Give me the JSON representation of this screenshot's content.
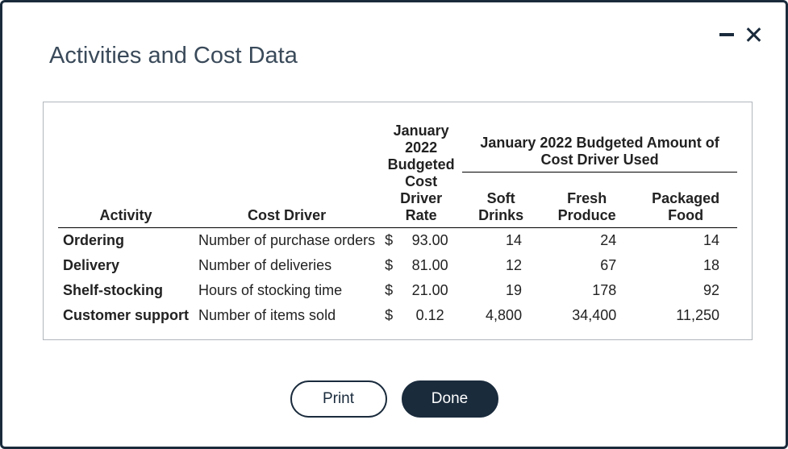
{
  "title": "Activities and Cost Data",
  "headers": {
    "activity": "Activity",
    "cost_driver": "Cost Driver",
    "rate": "January 2022 Budgeted Cost Driver Rate",
    "group": "January 2022 Budgeted Amount of Cost Driver Used",
    "soft_drinks": "Soft Drinks",
    "fresh_produce": "Fresh Produce",
    "packaged_food": "Packaged Food"
  },
  "rows": [
    {
      "activity": "Ordering",
      "driver": "Number of purchase orders",
      "currency": "$",
      "rate": "93.00",
      "soft": "14",
      "fresh": "24",
      "packaged": "14"
    },
    {
      "activity": "Delivery",
      "driver": "Number of deliveries",
      "currency": "$",
      "rate": "81.00",
      "soft": "12",
      "fresh": "67",
      "packaged": "18"
    },
    {
      "activity": "Shelf-stocking",
      "driver": "Hours of stocking time",
      "currency": "$",
      "rate": "21.00",
      "soft": "19",
      "fresh": "178",
      "packaged": "92"
    },
    {
      "activity": "Customer support",
      "driver": "Number of items sold",
      "currency": "$",
      "rate": "0.12",
      "soft": "4,800",
      "fresh": "34,400",
      "packaged": "11,250"
    }
  ],
  "buttons": {
    "print": "Print",
    "done": "Done"
  },
  "chart_data": {
    "type": "table",
    "title": "Activities and Cost Data",
    "columns": [
      "Activity",
      "Cost Driver",
      "January 2022 Budgeted Cost Driver Rate",
      "Soft Drinks",
      "Fresh Produce",
      "Packaged Food"
    ],
    "column_group": {
      "label": "January 2022 Budgeted Amount of Cost Driver Used",
      "spans": [
        "Soft Drinks",
        "Fresh Produce",
        "Packaged Food"
      ]
    },
    "rows": [
      {
        "Activity": "Ordering",
        "Cost Driver": "Number of purchase orders",
        "Rate": 93.0,
        "Soft Drinks": 14,
        "Fresh Produce": 24,
        "Packaged Food": 14
      },
      {
        "Activity": "Delivery",
        "Cost Driver": "Number of deliveries",
        "Rate": 81.0,
        "Soft Drinks": 12,
        "Fresh Produce": 67,
        "Packaged Food": 18
      },
      {
        "Activity": "Shelf-stocking",
        "Cost Driver": "Hours of stocking time",
        "Rate": 21.0,
        "Soft Drinks": 19,
        "Fresh Produce": 178,
        "Packaged Food": 92
      },
      {
        "Activity": "Customer support",
        "Cost Driver": "Number of items sold",
        "Rate": 0.12,
        "Soft Drinks": 4800,
        "Fresh Produce": 34400,
        "Packaged Food": 11250
      }
    ],
    "currency_symbol": "$"
  }
}
